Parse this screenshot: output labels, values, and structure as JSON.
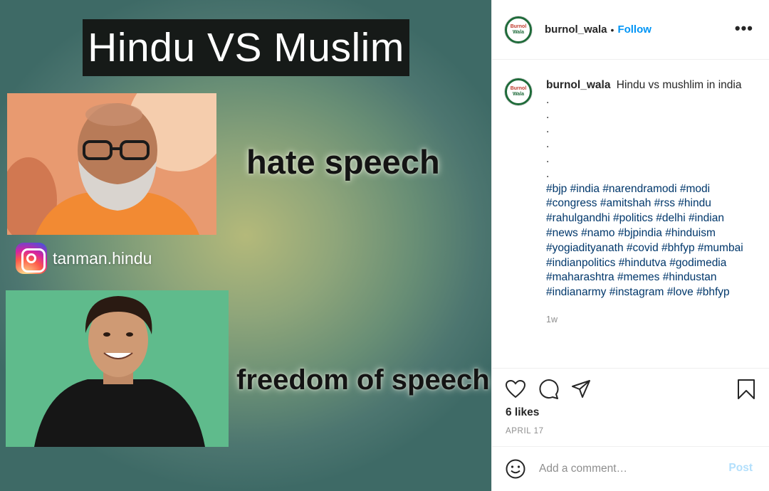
{
  "image": {
    "title": "Hindu VS Muslim",
    "top_caption": "hate speech",
    "bottom_caption": "freedom of speech",
    "instagram_handle": "tanman.hindu"
  },
  "header": {
    "avatar_line1": "Burnol",
    "avatar_line2": "Wala",
    "username": "burnol_wala",
    "separator": "•",
    "follow_label": "Follow",
    "more_label": "•••"
  },
  "caption": {
    "username": "burnol_wala",
    "text": "Hindu vs mushlim in india",
    "dots": [
      ".",
      ".",
      ".",
      ".",
      ".",
      "."
    ],
    "hashtags": [
      "#bjp",
      "#india",
      "#narendramodi",
      "#modi",
      "#congress",
      "#amitshah",
      "#rss",
      "#hindu",
      "#rahulgandhi",
      "#politics",
      "#delhi",
      "#indian",
      "#news",
      "#namo",
      "#bjpindia",
      "#hinduism",
      "#yogiadityanath",
      "#covid",
      "#bhfyp",
      "#mumbai",
      "#indianpolitics",
      "#hindutva",
      "#godimedia",
      "#maharashtra",
      "#memes",
      "#hindustan",
      "#indianarmy",
      "#instagram",
      "#love",
      "#bhfyp"
    ],
    "time_ago": "1w"
  },
  "actions": {
    "icons": [
      "heart-icon",
      "comment-icon",
      "share-icon",
      "bookmark-icon"
    ],
    "likes": "6 likes",
    "date": "APRIL 17"
  },
  "comment": {
    "placeholder": "Add a comment…",
    "post_label": "Post",
    "emoji_icon": "smiley-icon"
  },
  "colors": {
    "link_blue": "#0095f6",
    "hashtag": "#00376b",
    "post_disabled": "#b2dffc"
  }
}
